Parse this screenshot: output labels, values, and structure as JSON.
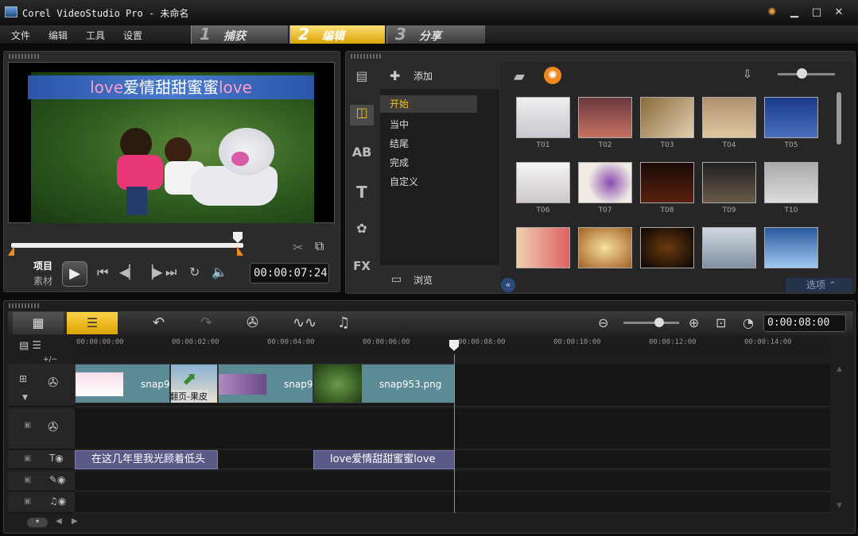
{
  "window": {
    "title": "Corel VideoStudio Pro - 未命名"
  },
  "menu": [
    "文件",
    "编辑",
    "工具",
    "设置"
  ],
  "steps": [
    {
      "num": "1",
      "label": "捕获"
    },
    {
      "num": "2",
      "label": "编辑"
    },
    {
      "num": "3",
      "label": "分享"
    }
  ],
  "preview": {
    "banner_pre": "love",
    "banner_mid": "爱情甜甜蜜蜜",
    "banner_post": "love",
    "mode_project": "项目",
    "mode_clip": "素材",
    "timecode": "00:00:07:24"
  },
  "library": {
    "add_label": "添加",
    "categories": [
      "开始",
      "当中",
      "结尾",
      "完成",
      "自定义"
    ],
    "browse_label": "浏览",
    "options_label": "选项",
    "thumbnails": [
      "T01",
      "T02",
      "T03",
      "T04",
      "T05",
      "T06",
      "T07",
      "T08",
      "T09",
      "T10"
    ]
  },
  "timeline": {
    "duration": "0:00:08:00",
    "ruler": [
      "00:00:00:00",
      "00:00:02:00",
      "00:00:04:00",
      "00:00:06:00",
      "00:00:08:00",
      "00:00:10:00",
      "00:00:12:00",
      "00:00:14:00"
    ],
    "video_clips": [
      "snap9",
      "翻页-果皮",
      "snap9",
      "snap953.png"
    ],
    "title_clips": [
      "在这几年里我光顾着低头",
      "love爱情甜甜蜜蜜love"
    ],
    "add_remove": "+/−"
  },
  "colors": {
    "accent": "#f2c21c",
    "title_clip": "#5a5a86",
    "video_clip": "#5c8a95"
  }
}
